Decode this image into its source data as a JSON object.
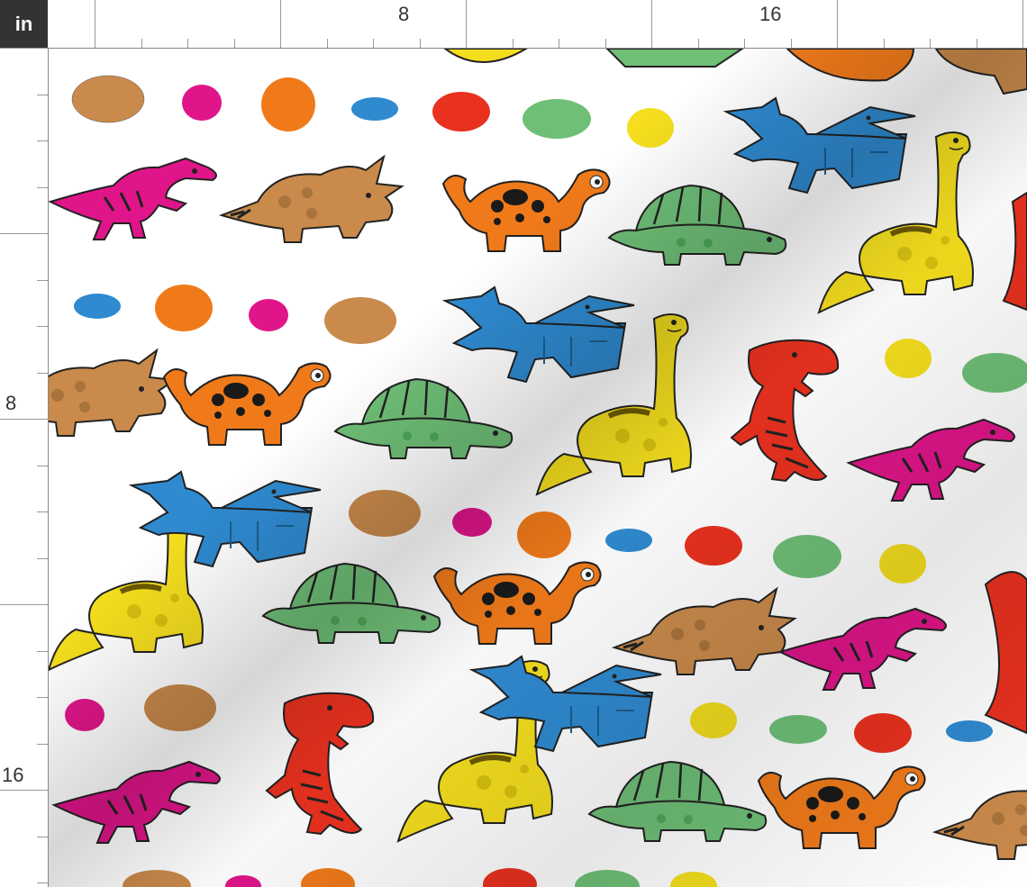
{
  "ruler": {
    "unit": "in",
    "top_labels": [
      "8",
      "16"
    ],
    "left_labels": [
      "8",
      "16"
    ]
  },
  "palette": {
    "orange": "#f07a1a",
    "green": "#6fbf77",
    "blue": "#2f8ad0",
    "yellow": "#f4de1e",
    "pink": "#e0158a",
    "red": "#e9311f",
    "brown": "#c98a4b"
  },
  "dinosaurs": [
    "parasaurolophus",
    "triceratops",
    "brontosaurus-spotted",
    "dimetrodon",
    "pterodactyl",
    "brachiosaurus",
    "t-rex"
  ],
  "eggs": [
    "brown",
    "pink",
    "orange",
    "blue",
    "red",
    "green",
    "yellow"
  ]
}
